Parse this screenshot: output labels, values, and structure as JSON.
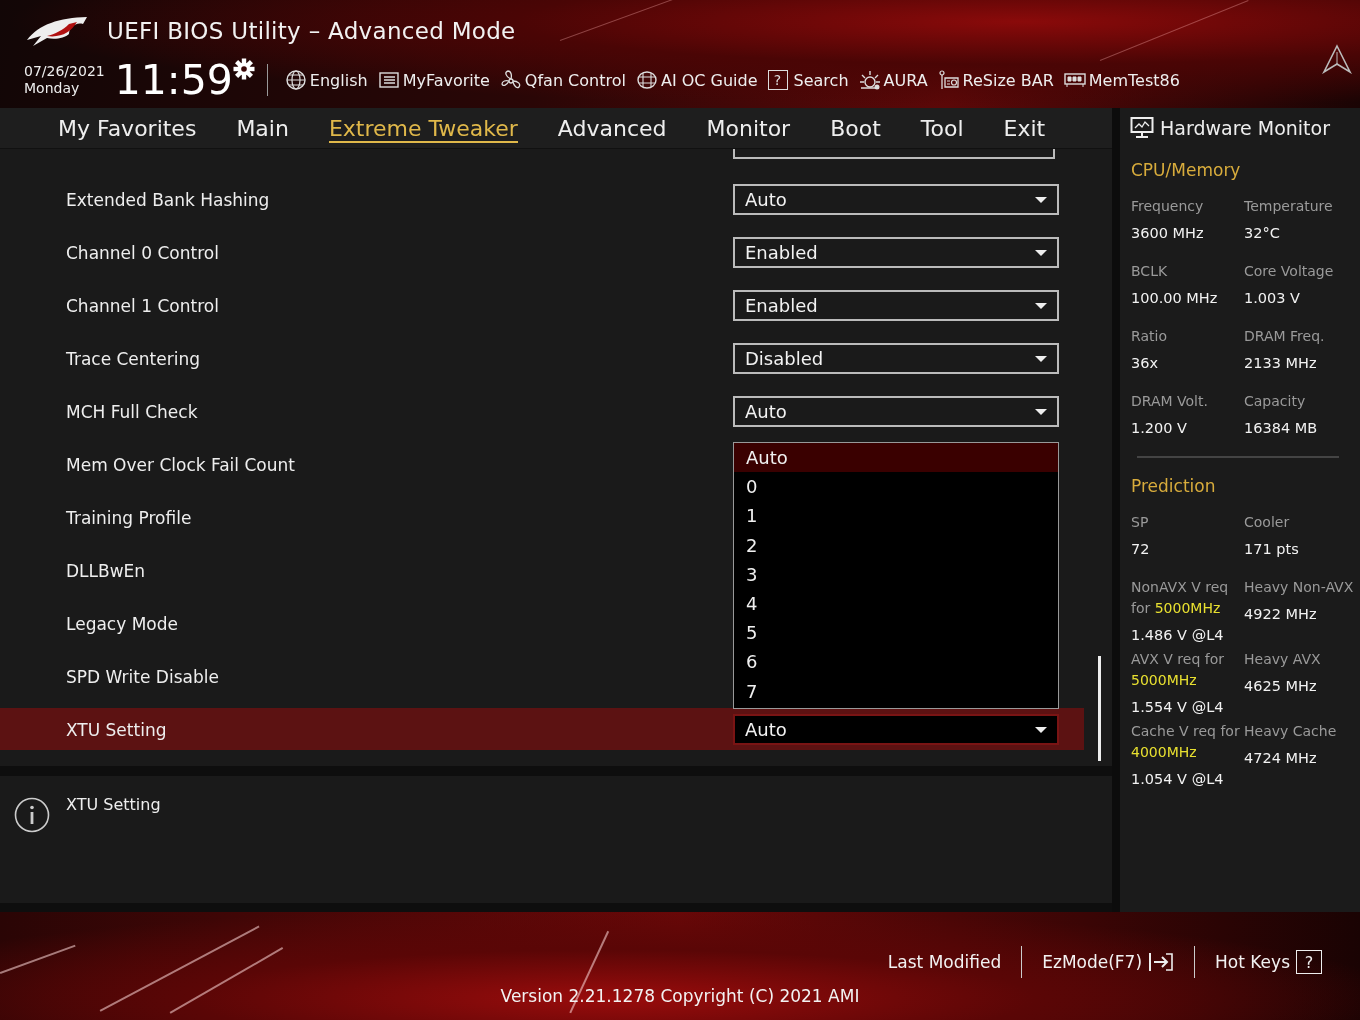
{
  "window": {
    "title": "UEFI BIOS Utility – Advanced Mode"
  },
  "clock": {
    "date": "07/26/2021",
    "day": "Monday",
    "time": "11:59"
  },
  "toolbar": [
    {
      "label": "English"
    },
    {
      "label": "MyFavorite"
    },
    {
      "label": "Qfan Control"
    },
    {
      "label": "AI OC Guide"
    },
    {
      "label": "Search",
      "glyph": "?"
    },
    {
      "label": "AURA"
    },
    {
      "label": "ReSize BAR"
    },
    {
      "label": "MemTest86"
    }
  ],
  "tabs": [
    {
      "label": "My Favorites",
      "selected": false
    },
    {
      "label": "Main",
      "selected": false
    },
    {
      "label": "Extreme Tweaker",
      "selected": true
    },
    {
      "label": "Advanced",
      "selected": false
    },
    {
      "label": "Monitor",
      "selected": false
    },
    {
      "label": "Boot",
      "selected": false
    },
    {
      "label": "Tool",
      "selected": false
    },
    {
      "label": "Exit",
      "selected": false
    }
  ],
  "settings": [
    {
      "label": "Extended Bank Hashing",
      "value": "Auto",
      "selected": false
    },
    {
      "label": "Channel 0 Control",
      "value": "Enabled",
      "selected": false
    },
    {
      "label": "Channel 1 Control",
      "value": "Enabled",
      "selected": false
    },
    {
      "label": "Trace Centering",
      "value": "Disabled",
      "selected": false
    },
    {
      "label": "MCH Full Check",
      "value": "Auto",
      "selected": false
    },
    {
      "label": "Mem Over Clock Fail Count",
      "selected": false
    },
    {
      "label": "Training Profile",
      "selected": false
    },
    {
      "label": "DLLBwEn",
      "selected": false
    },
    {
      "label": "Legacy Mode",
      "selected": false
    },
    {
      "label": "SPD Write Disable",
      "selected": false
    },
    {
      "label": "XTU Setting",
      "value": "Auto",
      "selected": true
    }
  ],
  "dropdown_options": [
    {
      "label": "Auto",
      "selected": true
    },
    {
      "label": "0",
      "selected": false
    },
    {
      "label": "1",
      "selected": false
    },
    {
      "label": "2",
      "selected": false
    },
    {
      "label": "3",
      "selected": false
    },
    {
      "label": "4",
      "selected": false
    },
    {
      "label": "5",
      "selected": false
    },
    {
      "label": "6",
      "selected": false
    },
    {
      "label": "7",
      "selected": false
    }
  ],
  "help": {
    "text": "XTU Setting"
  },
  "hardware_monitor": {
    "title": "Hardware Monitor",
    "sections": [
      {
        "title": "CPU/Memory",
        "items": [
          {
            "label": "Frequency",
            "value": "3600 MHz"
          },
          {
            "label": "Temperature",
            "value": "32°C"
          },
          {
            "label": "BCLK",
            "value": "100.00 MHz"
          },
          {
            "label": "Core Voltage",
            "value": "1.003 V"
          },
          {
            "label": "Ratio",
            "value": "36x"
          },
          {
            "label": "DRAM Freq.",
            "value": "2133 MHz"
          },
          {
            "label": "DRAM Volt.",
            "value": "1.200 V"
          },
          {
            "label": "Capacity",
            "value": "16384 MB"
          }
        ]
      },
      {
        "title": "Prediction",
        "items": [
          {
            "label": "SP",
            "value": "72"
          },
          {
            "label": "Cooler",
            "value": "171 pts"
          },
          {
            "label": "NonAVX V req for **5000MHz**",
            "value": "1.486 V @L4"
          },
          {
            "label": "Heavy Non-AVX",
            "value": "4922 MHz"
          },
          {
            "label": "AVX V req for **5000MHz**",
            "value": "1.554 V @L4"
          },
          {
            "label": "Heavy AVX",
            "value": "4625 MHz"
          },
          {
            "label": "Cache V req for **4000MHz**",
            "value": "1.054 V @L4"
          },
          {
            "label": "Heavy Cache",
            "value": "4724 MHz"
          }
        ]
      }
    ]
  },
  "footer": {
    "actions": [
      {
        "label": "Last Modified"
      },
      {
        "label": "EzMode(F7)"
      },
      {
        "label": "Hot Keys",
        "glyph": "?"
      }
    ],
    "version": "Version 2.21.1278 Copyright (C) 2021 AMI"
  }
}
